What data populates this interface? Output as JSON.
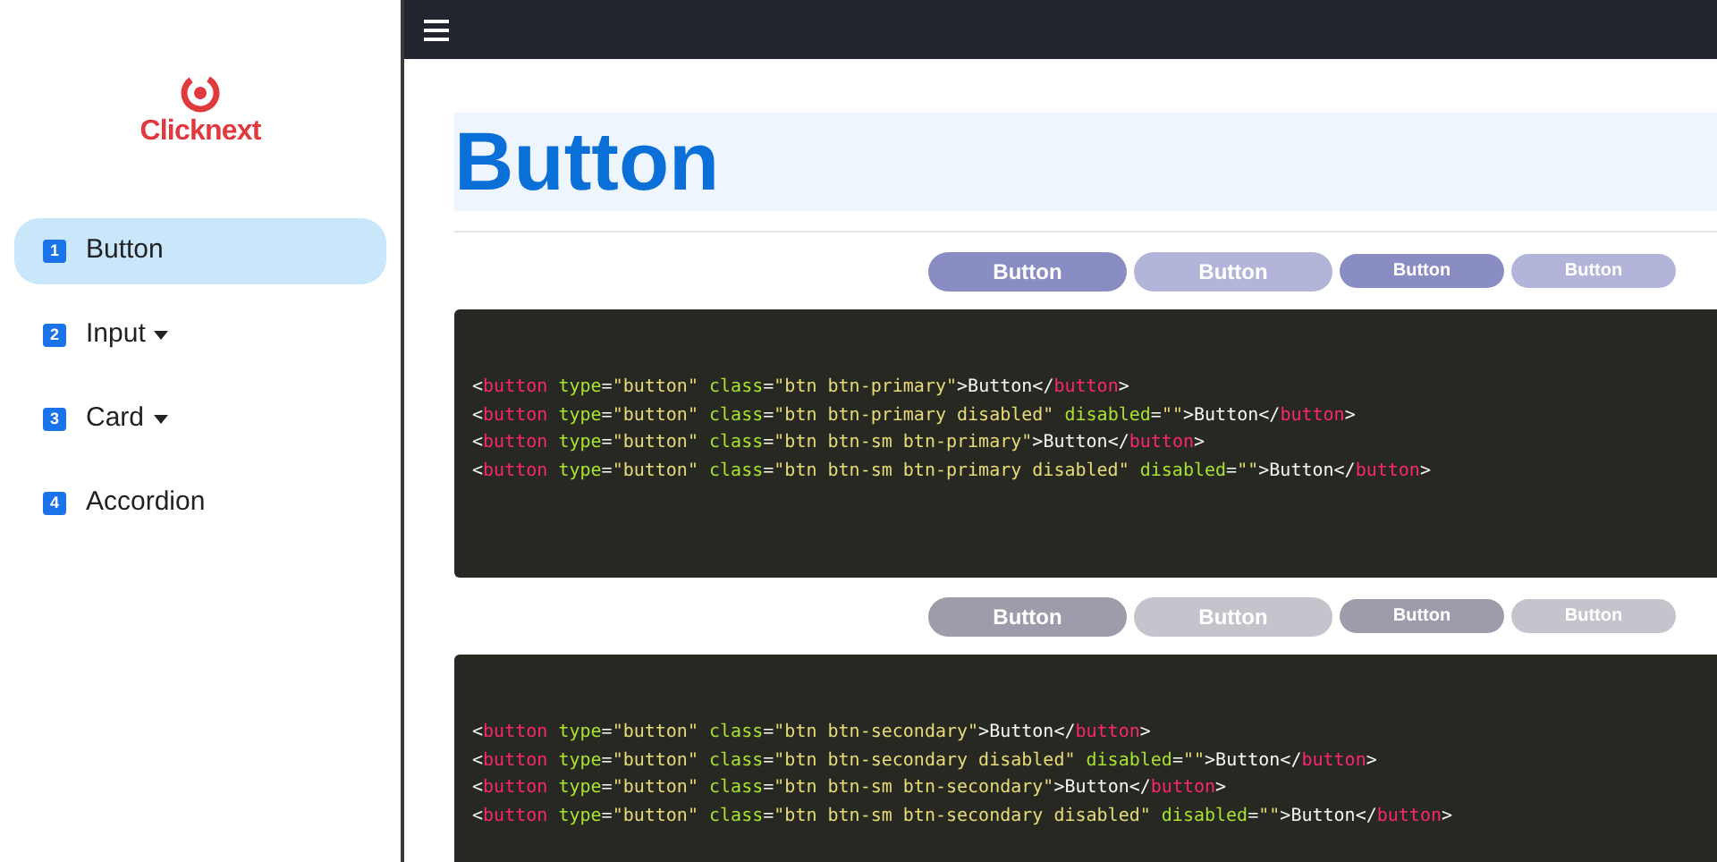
{
  "sidebar": {
    "logo_text": "Clicknext",
    "items": [
      {
        "number": "1",
        "label": "Button",
        "selected": true,
        "has_submenu": false
      },
      {
        "number": "2",
        "label": "Input",
        "selected": false,
        "has_submenu": true
      },
      {
        "number": "3",
        "label": "Card",
        "selected": false,
        "has_submenu": true
      },
      {
        "number": "4",
        "label": "Accordion",
        "selected": false,
        "has_submenu": false
      }
    ]
  },
  "page": {
    "title": "Button",
    "sections": [
      {
        "kind": "primary",
        "buttons": [
          {
            "label": "Button",
            "kind": "large",
            "disabled": false
          },
          {
            "label": "Button",
            "kind": "large",
            "disabled": true
          },
          {
            "label": "Button",
            "kind": "small",
            "disabled": false
          },
          {
            "label": "Button",
            "kind": "small",
            "disabled": true
          }
        ],
        "code": [
          "<button type=\"button\" class=\"btn btn-primary\">Button</button>",
          "<button type=\"button\" class=\"btn btn-primary disabled\" disabled=\"\">Button</button>",
          "<button type=\"button\" class=\"btn btn-sm btn-primary\">Button</button>",
          "<button type=\"button\" class=\"btn btn-sm btn-primary disabled\" disabled=\"\">Button</button>"
        ]
      },
      {
        "kind": "secondary",
        "buttons": [
          {
            "label": "Button",
            "kind": "large",
            "disabled": false
          },
          {
            "label": "Button",
            "kind": "large",
            "disabled": true
          },
          {
            "label": "Button",
            "kind": "small",
            "disabled": false
          },
          {
            "label": "Button",
            "kind": "small",
            "disabled": true
          }
        ],
        "code": [
          "<button type=\"button\" class=\"btn btn-secondary\">Button</button>",
          "<button type=\"button\" class=\"btn btn-secondary disabled\" disabled=\"\">Button</button>",
          "<button type=\"button\" class=\"btn btn-sm btn-secondary\">Button</button>",
          "<button type=\"button\" class=\"btn btn-sm btn-secondary disabled\" disabled=\"\">Button</button>"
        ]
      }
    ]
  }
}
